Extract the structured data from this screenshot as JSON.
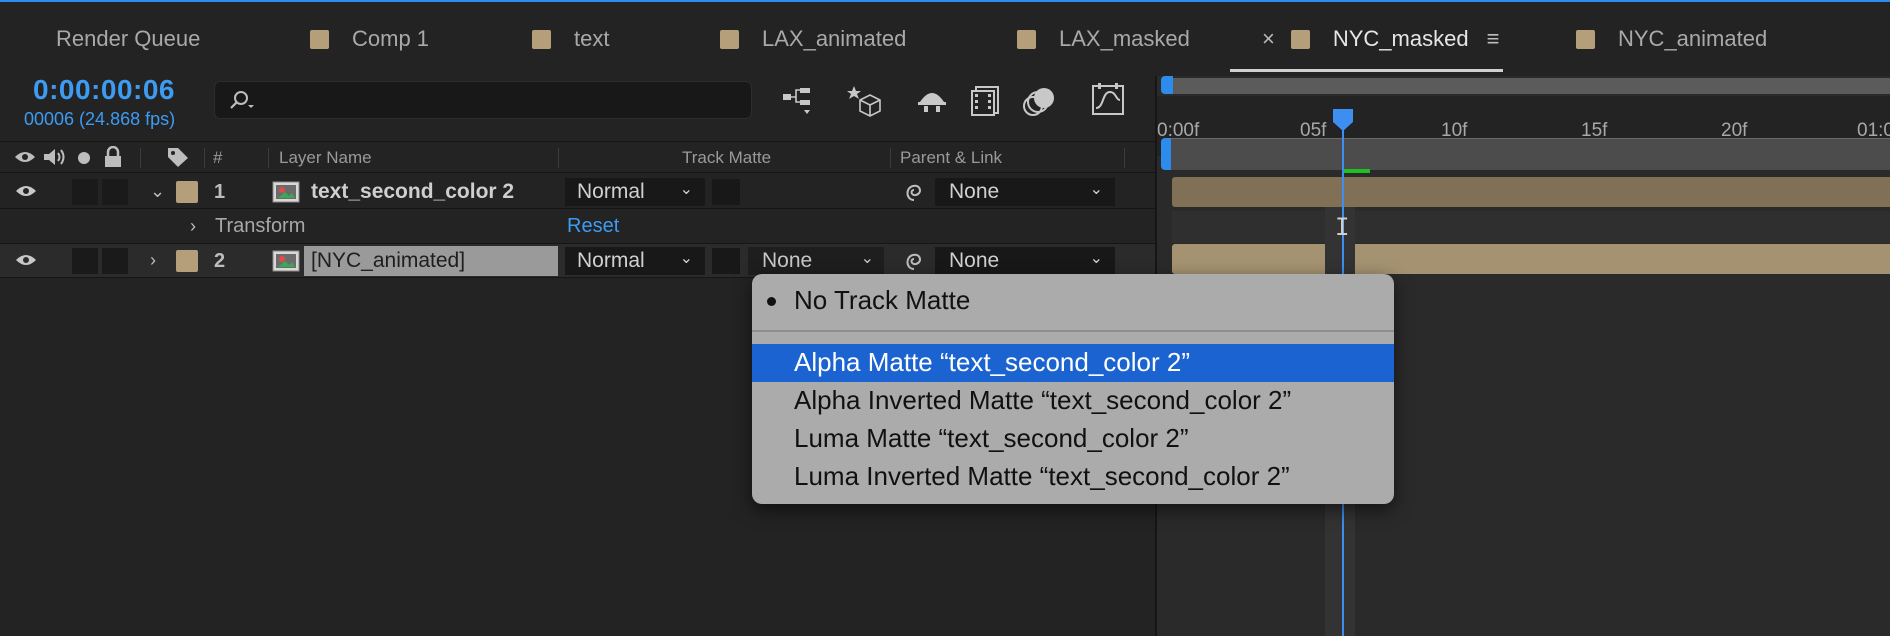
{
  "tabs": [
    {
      "label": "Render Queue",
      "swatch": false,
      "active": false
    },
    {
      "label": "Comp 1",
      "swatch": true,
      "active": false
    },
    {
      "label": "text",
      "swatch": true,
      "active": false
    },
    {
      "label": "LAX_animated",
      "swatch": true,
      "active": false
    },
    {
      "label": "LAX_masked",
      "swatch": true,
      "active": false
    },
    {
      "label": "NYC_masked",
      "swatch": true,
      "active": true
    },
    {
      "label": "NYC_animated",
      "swatch": true,
      "active": false
    }
  ],
  "tab_close": "×",
  "tab_menu": "≡",
  "time": {
    "timecode": "0:00:00:06",
    "frames": "00006 (24.868 fps)"
  },
  "columns": {
    "hash": "#",
    "layer_name": "Layer Name",
    "track_matte": "Track Matte",
    "parent_link": "Parent & Link"
  },
  "layers": [
    {
      "number": "1",
      "name": "text_second_color 2",
      "mode": "Normal",
      "track_matte": "",
      "parent": "None"
    },
    {
      "number": "2",
      "name": "[NYC_animated]",
      "mode": "Normal",
      "track_matte": "None",
      "parent": "None"
    }
  ],
  "transform": {
    "label": "Transform",
    "reset": "Reset"
  },
  "ruler": {
    "labels": [
      "0:00f",
      "05f",
      "10f",
      "15f",
      "20f",
      "01:0"
    ]
  },
  "dropdown": {
    "items": [
      {
        "label": "No Track Matte",
        "checked": true,
        "selected": false
      },
      {
        "label": "Alpha Matte “text_second_color 2”",
        "checked": false,
        "selected": true
      },
      {
        "label": "Alpha Inverted Matte “text_second_color 2”",
        "checked": false,
        "selected": false
      },
      {
        "label": "Luma Matte “text_second_color 2”",
        "checked": false,
        "selected": false
      },
      {
        "label": "Luma Inverted Matte “text_second_color 2”",
        "checked": false,
        "selected": false
      }
    ]
  },
  "colors": {
    "accent": "#2d8ceb",
    "label_swatch": "#b59e7a",
    "menu_highlight": "#1a63d1"
  }
}
